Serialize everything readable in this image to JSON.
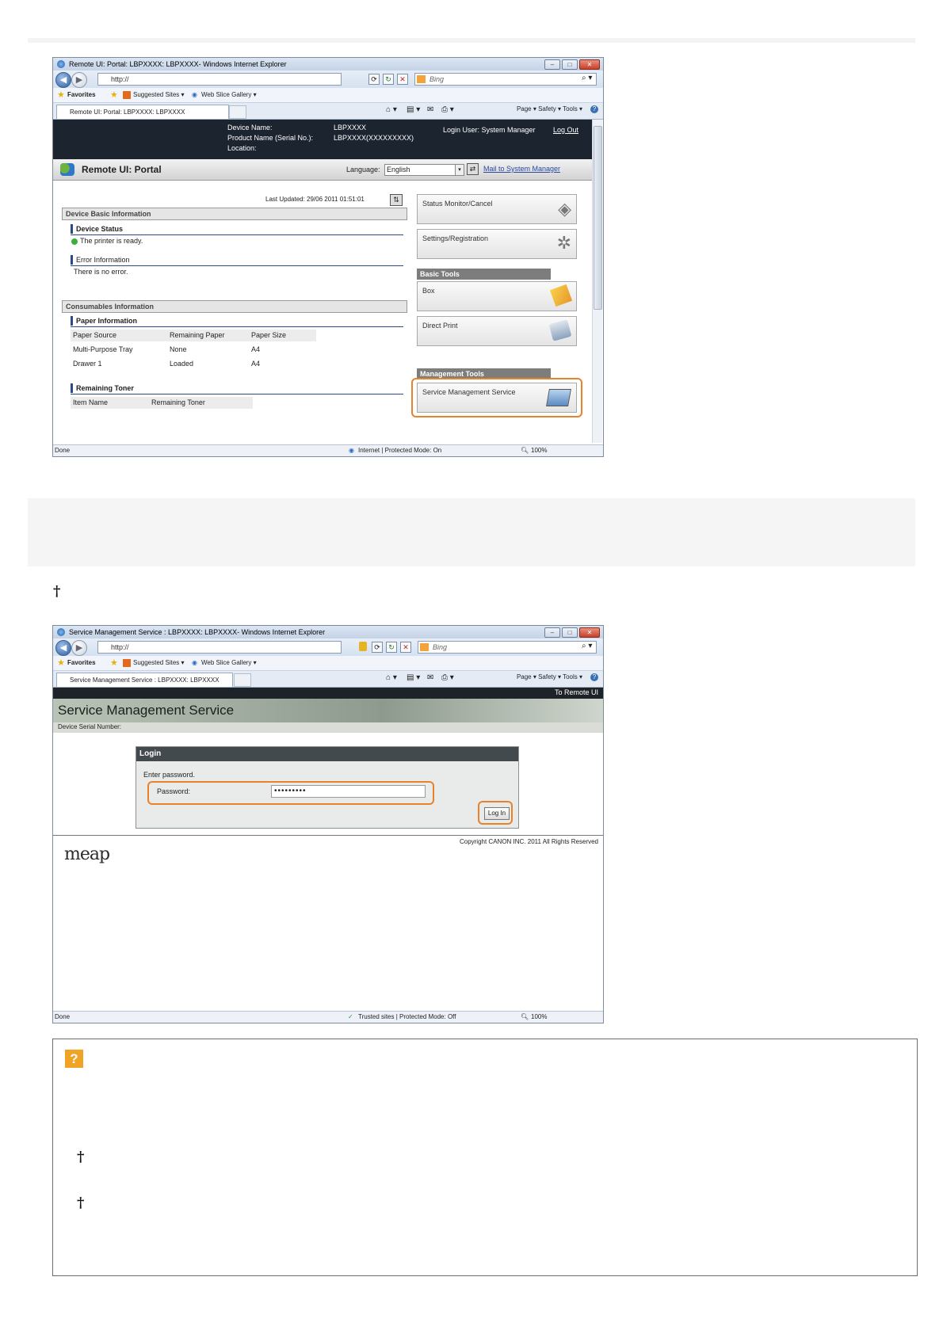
{
  "colors": {
    "highlight": "#e8822c",
    "portal_header": "#1c2430",
    "gray_band": "#f5f5f5"
  },
  "dagger_mark": "†",
  "shot1": {
    "window_title": "Remote UI: Portal: LBPXXXX: LBPXXXX- Windows Internet Explorer",
    "url": "http://",
    "search_placeholder": "Bing",
    "favorites": "Favorites",
    "suggested_sites": "Suggested Sites ▾",
    "web_slice_gallery": "Web Slice Gallery ▾",
    "tab_label": "Remote UI: Portal: LBPXXXX: LBPXXXX",
    "command_bar": "Page ▾   Safety ▾   Tools ▾",
    "header": {
      "device_name_label": "Device Name:",
      "device_name_value": "LBPXXXX",
      "product_name_label": "Product Name (Serial No.):",
      "product_name_value": "LBPXXXX(XXXXXXXXX)",
      "location_label": "Location:",
      "login_user": "Login User: System Manager",
      "logout": "Log Out"
    },
    "portal_title": "Remote UI: Portal",
    "language_label": "Language:",
    "language_value": "English",
    "mail_link": "Mail to System Manager",
    "last_updated": "Last Updated: 29/06 2011 01:51:01",
    "device_basic_info": "Device Basic Information",
    "device_status": "Device Status",
    "status_text": "The printer is ready.",
    "error_info": "Error Information",
    "error_text": "There is no error.",
    "consumables_info": "Consumables Information",
    "paper_info": "Paper Information",
    "paper_table": {
      "headers": [
        "Paper Source",
        "Remaining Paper",
        "Paper Size"
      ],
      "rows": [
        [
          "Multi-Purpose Tray",
          "None",
          "A4"
        ],
        [
          "Drawer 1",
          "Loaded",
          "A4"
        ]
      ]
    },
    "remaining_toner": "Remaining Toner",
    "toner_headers": [
      "Item Name",
      "Remaining Toner"
    ],
    "tiles": {
      "status_monitor": "Status Monitor/Cancel",
      "settings": "Settings/Registration",
      "basic_tools": "Basic Tools",
      "box": "Box",
      "direct_print": "Direct Print",
      "management_tools": "Management Tools",
      "service_management": "Service Management Service"
    },
    "statusbar": {
      "left": "Done",
      "zone": "Internet | Protected Mode: On",
      "zoom": "100%"
    }
  },
  "shot2": {
    "window_title": "Service Management Service : LBPXXXX: LBPXXXX- Windows Internet Explorer",
    "url": "http://",
    "search_placeholder": "Bing",
    "favorites": "Favorites",
    "suggested_sites": "Suggested Sites ▾",
    "web_slice_gallery": "Web Slice Gallery ▾",
    "tab_label": "Service Management Service : LBPXXXX: LBPXXXX",
    "command_bar": "Page ▾   Safety ▾   Tools ▾",
    "to_remote_ui": "To Remote UI",
    "page_title": "Service Management Service",
    "serial_label": "Device Serial Number:",
    "login_title": "Login",
    "enter_password": "Enter password.",
    "password_label": "Password:",
    "password_value": "•••••••••",
    "login_button": "Log In",
    "copyright": "Copyright CANON INC. 2011 All Rights Reserved",
    "logo": "meap",
    "statusbar": {
      "left": "Done",
      "zone": "Trusted sites | Protected Mode: Off",
      "zoom": "100%"
    }
  }
}
